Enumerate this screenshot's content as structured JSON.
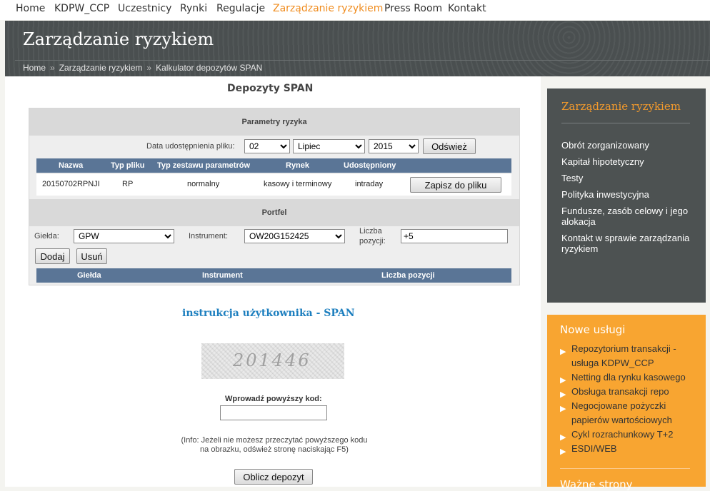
{
  "nav": {
    "items": [
      "Home",
      "KDPW_CCP",
      "Uczestnicy",
      "Rynki",
      "Regulacje",
      "Zarządzanie ryzykiem",
      "Press Room",
      "Kontakt"
    ],
    "active_index": 5
  },
  "banner": {
    "title": "Zarządzanie ryzykiem",
    "breadcrumb": [
      "Home",
      "Zarządzanie ryzykiem",
      "Kalkulator depozytów SPAN"
    ],
    "separator": "»"
  },
  "calc": {
    "title": "Depozyty SPAN",
    "params_header": "Parametry ryzyka",
    "date_label": "Data udostępnienia pliku:",
    "day": "02",
    "month": "Lipiec",
    "year": "2015",
    "refresh_button": "Odśwież",
    "columns": [
      "Nazwa",
      "Typ pliku",
      "Typ zestawu parametrów",
      "Rynek",
      "Udostępniony"
    ],
    "row": {
      "name": "20150702RPNJI",
      "file_type": "RP",
      "set_type": "normalny",
      "market": "kasowy i terminowy",
      "shared": "intraday"
    },
    "save_button": "Zapisz do pliku",
    "portfolio_header": "Portfel",
    "exchange_label": "Giełda:",
    "exchange_value": "GPW",
    "instrument_label": "Instrument:",
    "instrument_value": "OW20G152425",
    "positions_label_1": "Liczba",
    "positions_label_2": "pozycji:",
    "positions_value": "+5",
    "add_button": "Dodaj",
    "remove_button": "Usuń",
    "portfolio_columns": [
      "Giełda",
      "Instrument",
      "Liczba pozycji"
    ]
  },
  "instructions_link": "instrukcja użytkownika - SPAN",
  "captcha": {
    "code_image_text": "201446",
    "label": "Wprowadź powyższy kod:",
    "input_value": "",
    "info_line1": "(Info: Jeżeli nie możesz przeczytać powyższego kodu",
    "info_line2": "na obrazku, odśwież stronę naciskając F5)",
    "submit_button": "Oblicz depozyt"
  },
  "sidebar": {
    "title": "Zarządzanie ryzykiem",
    "links": [
      "Obrót zorganizowany",
      "Kapitał hipotetyczny",
      "Testy",
      "Polityka inwestycyjna",
      "Fundusze, zasób celowy i jego alokacja",
      "Kontakt w sprawie zarządzania ryzykiem"
    ]
  },
  "services": {
    "title": "Nowe usługi",
    "items": [
      "Repozytorium transakcji - usługa KDPW_CCP",
      "Netting dla rynku kasowego",
      "Obsługa transakcji repo",
      "Negocjowane pożyczki papierów wartościowych",
      "Cykl rozrachunkowy T+2",
      "ESDI/WEB"
    ],
    "second_title": "Ważne strony"
  },
  "colors": {
    "accent_orange": "#f08c1e",
    "banner_bg": "#4a4f50",
    "table_header": "#5a7596",
    "link_blue": "#1d7fbf",
    "services_bg": "#f8a531"
  }
}
